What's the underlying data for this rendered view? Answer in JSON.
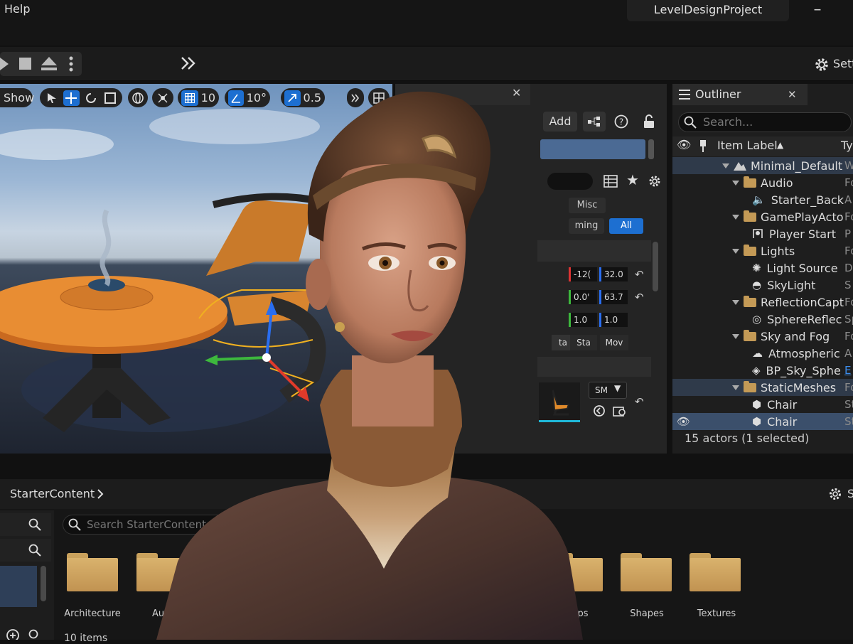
{
  "menu": {
    "help": "Help"
  },
  "window": {
    "project_name": "LevelDesignProject"
  },
  "toolbar": {
    "settings_label": "Sett"
  },
  "viewport": {
    "show_label": "Show",
    "grid_snap_value": "10",
    "rotation_snap_value": "10°",
    "scale_snap_value": "0.5"
  },
  "details": {
    "add_label": "Add",
    "filters": {
      "misc": "Misc",
      "streaming": "ming",
      "all": "All"
    },
    "location": [
      "-12(",
      "32.0"
    ],
    "rotation": [
      "0.0'",
      "63.7"
    ],
    "scale": [
      "1.0",
      "1.0"
    ],
    "mobility": [
      "ta",
      "Sta",
      "Mov"
    ],
    "mesh_dropdown": "SM"
  },
  "outliner": {
    "title": "Outliner",
    "search_placeholder": "Search...",
    "column_label": "Item Label",
    "column_type": "Ty",
    "rows": [
      {
        "label": "Minimal_Default",
        "type": "W"
      },
      {
        "label": "Audio",
        "type": "Fo"
      },
      {
        "label": "Starter_Back",
        "type": "A"
      },
      {
        "label": "GamePlayActo",
        "type": "Fo"
      },
      {
        "label": "Player Start",
        "type": "P"
      },
      {
        "label": "Lights",
        "type": "Fo"
      },
      {
        "label": "Light Source",
        "type": "D"
      },
      {
        "label": "SkyLight",
        "type": "S"
      },
      {
        "label": "ReflectionCapt",
        "type": "Fo"
      },
      {
        "label": "SphereReflec",
        "type": "Sp"
      },
      {
        "label": "Sky and Fog",
        "type": "Fo"
      },
      {
        "label": "Atmospheric",
        "type": "A"
      },
      {
        "label": "BP_Sky_Sphe",
        "type": "E"
      },
      {
        "label": "StaticMeshes",
        "type": "Fo"
      },
      {
        "label": "Chair",
        "type": "St"
      },
      {
        "label": "Chair",
        "type": "St"
      }
    ],
    "status": "15 actors (1 selected)"
  },
  "content_browser": {
    "breadcrumb": "StarterContent",
    "search_placeholder": "Search StarterContent",
    "folders": [
      {
        "label": "Architecture"
      },
      {
        "label": "Au"
      },
      {
        "label": "ops"
      },
      {
        "label": "Shapes"
      },
      {
        "label": "Textures"
      }
    ],
    "items_count": "10 items"
  },
  "colors": {
    "accent_blue": "#1d6fd1",
    "folder": "#c9a15c",
    "panel": "#242424",
    "selected_row": "#2f3a4a"
  }
}
